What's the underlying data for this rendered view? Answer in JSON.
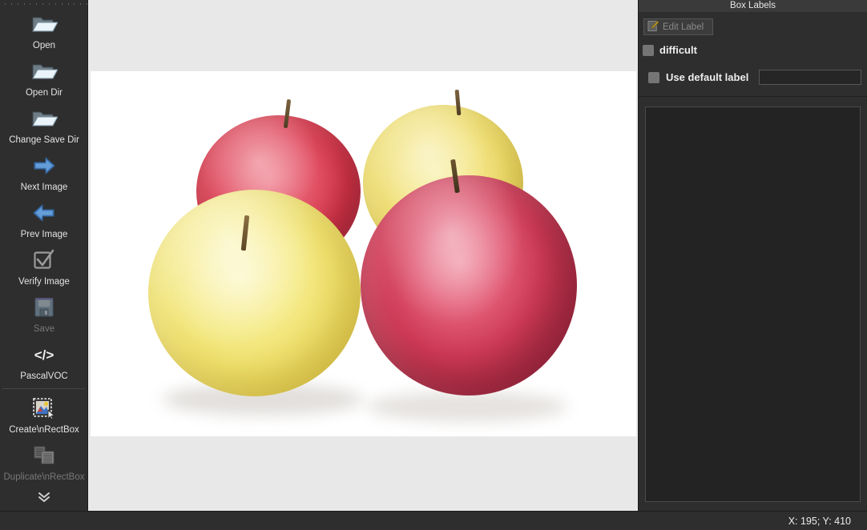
{
  "toolbar": {
    "items": [
      {
        "label": "Open",
        "icon": "open-folder-icon",
        "enabled": true
      },
      {
        "label": "Open Dir",
        "icon": "open-folder-icon",
        "enabled": true
      },
      {
        "label": "Change Save Dir",
        "icon": "open-folder-icon",
        "enabled": true
      },
      {
        "label": "Next Image",
        "icon": "arrow-right-icon",
        "enabled": true
      },
      {
        "label": "Prev Image",
        "icon": "arrow-left-icon",
        "enabled": true
      },
      {
        "label": "Verify Image",
        "icon": "checkbox-check-icon",
        "enabled": true
      },
      {
        "label": "Save",
        "icon": "floppy-disk-icon",
        "enabled": false
      },
      {
        "label": "PascalVOC",
        "icon": "code-brackets-icon",
        "enabled": true
      },
      {
        "label": "Create\\nRectBox",
        "icon": "create-rectbox-icon",
        "enabled": true
      },
      {
        "label": "Duplicate\\nRectBox",
        "icon": "duplicate-rectbox-icon",
        "enabled": false
      }
    ],
    "more_icon": "double-chevron-down-icon"
  },
  "dock": {
    "title": "Box Labels",
    "edit_label_button": "Edit Label",
    "edit_label_icon": "pencil-edit-icon",
    "difficult_label": "difficult",
    "difficult_checked": false,
    "use_default_label": "Use default label",
    "use_default_checked": false,
    "default_label_value": "",
    "default_label_placeholder": ""
  },
  "statusbar": {
    "coordinates": "X: 195; Y: 410"
  },
  "canvas": {
    "image_alt": "four apples on white background",
    "background_color": "#e8e8e8",
    "photo_background": "#ffffff"
  },
  "colors": {
    "panel": "#2e2e2e",
    "panel_header": "#3a3a3a",
    "list_background": "#232323",
    "text": "#ededed",
    "text_disabled": "#787878"
  }
}
